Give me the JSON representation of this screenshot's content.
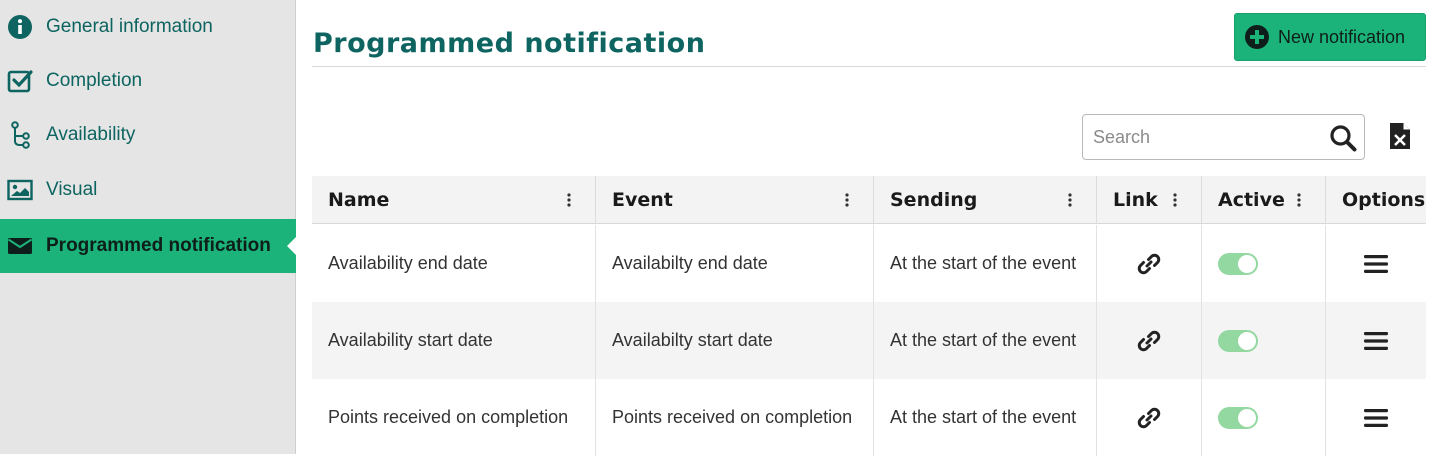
{
  "sidebar": {
    "items": [
      {
        "label": "General information",
        "icon": "info-circle-icon"
      },
      {
        "label": "Completion",
        "icon": "checkbox-icon"
      },
      {
        "label": "Availability",
        "icon": "branch-icon"
      },
      {
        "label": "Visual",
        "icon": "image-icon"
      },
      {
        "label": "Programmed notification",
        "icon": "envelope-icon",
        "active": true
      }
    ]
  },
  "header": {
    "title": "Programmed notification",
    "new_button_label": "New notification"
  },
  "search": {
    "placeholder": "Search",
    "value": ""
  },
  "table": {
    "columns": [
      "Name",
      "Event",
      "Sending",
      "Link",
      "Active",
      "Options"
    ],
    "rows": [
      {
        "name": "Availability end date",
        "event": "Availabilty end date",
        "sending": "At the start of the event",
        "active": true
      },
      {
        "name": "Availability start date",
        "event": "Availabilty start date",
        "sending": "At the start of the event",
        "active": true
      },
      {
        "name": "Points received on completion",
        "event": "Points received on completion",
        "sending": "At the start of the event",
        "active": true
      }
    ]
  },
  "colors": {
    "accent": "#1cb37a",
    "brand_text": "#0d6460",
    "toggle_on": "#93d8a0"
  }
}
